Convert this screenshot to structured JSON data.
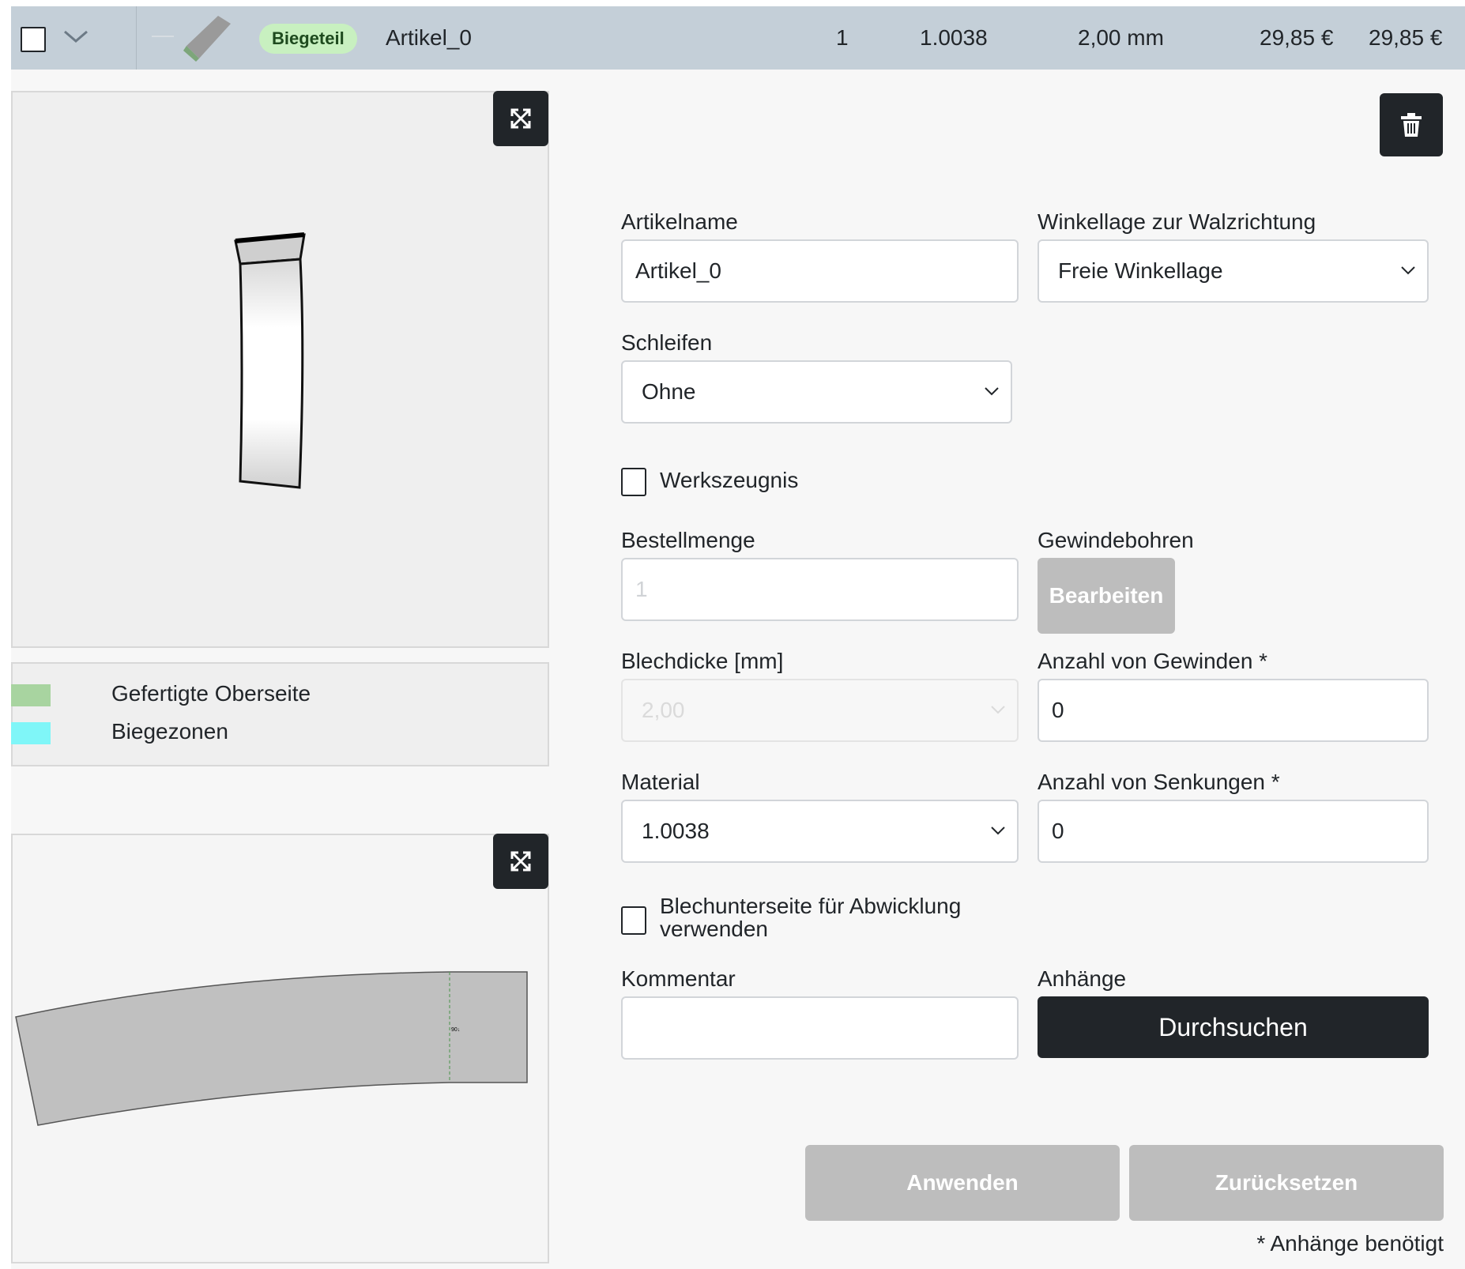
{
  "header": {
    "type_badge": "Biegeteil",
    "article_name": "Artikel_0",
    "quantity": "1",
    "material": "1.0038",
    "thickness": "2,00 mm",
    "unit_price": "29,85 €",
    "total_price": "29,85 €"
  },
  "legend": {
    "items": [
      {
        "label": "Gefertigte Oberseite",
        "color": "#a8d4a0"
      },
      {
        "label": "Biegezonen",
        "color": "#7ff6f8"
      }
    ]
  },
  "form": {
    "article_name_label": "Artikelname",
    "article_name_value": "Artikel_0",
    "angle_label": "Winkellage zur Walzrichtung",
    "angle_value": "Freie Winkellage",
    "grinding_label": "Schleifen",
    "grinding_value": "Ohne",
    "certificate_label": "Werkszeugnis",
    "order_qty_label": "Bestellmenge",
    "order_qty_placeholder": "1",
    "threading_label": "Gewindebohren",
    "threading_button": "Bearbeiten",
    "thickness_label": "Blechdicke [mm]",
    "thickness_value": "2,00",
    "threads_count_label": "Anzahl von Gewinden *",
    "threads_count_value": "0",
    "material_label": "Material",
    "material_value": "1.0038",
    "countersinks_label": "Anzahl von Senkungen *",
    "countersinks_value": "0",
    "underside_label_line1": "Blechunterseite für Abwicklung",
    "underside_label_line2": "verwenden",
    "comment_label": "Kommentar",
    "comment_value": "",
    "attachments_label": "Anhänge",
    "browse_button": "Durchsuchen",
    "apply_button": "Anwenden",
    "reset_button": "Zurücksetzen",
    "required_note": "* Anhänge benötigt"
  },
  "icons": {
    "expand": "expand-icon",
    "trash": "trash-icon",
    "chevron": "chevron-down-icon"
  }
}
